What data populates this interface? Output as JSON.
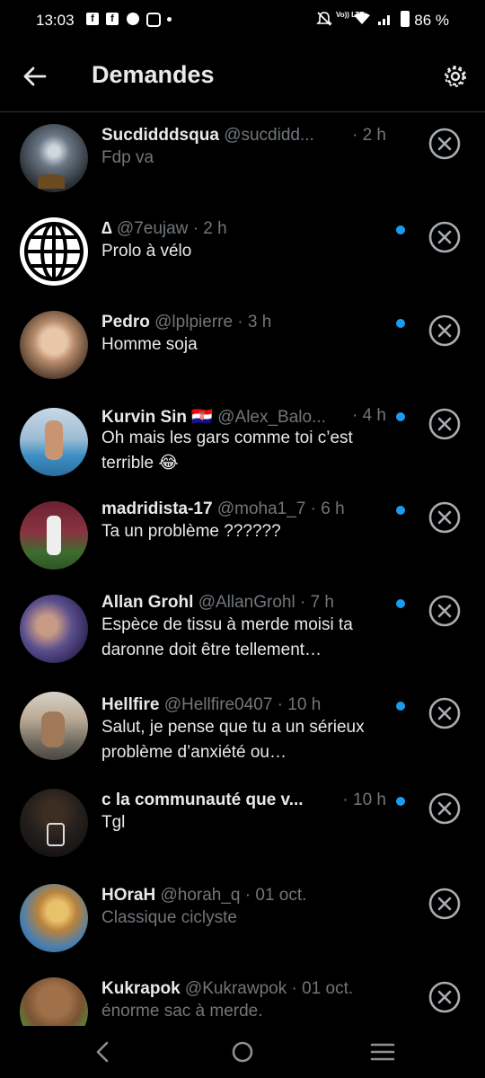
{
  "status_bar": {
    "time": "13:03",
    "left_icons": [
      "facebook-icon",
      "facebook-icon",
      "messenger-icon",
      "instagram-icon",
      "dot-icon"
    ],
    "volte": "Vo)) LTE",
    "battery": "86 %",
    "right_icons": [
      "mute-icon",
      "wifi-icon",
      "signal-icon",
      "battery-icon"
    ]
  },
  "header": {
    "title": "Demandes",
    "back_icon": "arrow-left-icon",
    "settings_icon": "gear-icon"
  },
  "requests": [
    {
      "name": "Sucdidddsqua",
      "handle": "@sucdidd...",
      "time": "· 2 h",
      "message": "Fdp va",
      "unread": false,
      "avatar": "night-sky-photo"
    },
    {
      "name": "∆",
      "handle": "@7eujaw",
      "time": "· 2 h",
      "message": "Prolo à vélo",
      "unread": true,
      "avatar": "globe-icon"
    },
    {
      "name": "Pedro",
      "handle": "@lplpierre",
      "time": "· 3 h",
      "message": "Homme soja",
      "unread": true,
      "avatar": "portrait-photo"
    },
    {
      "name": "Kurvin Sin 🇭🇷",
      "handle": "@Alex_Balo...",
      "time": "· 4 h",
      "message": "Oh mais les gars comme toi c’est terrible 😂",
      "unread": true,
      "avatar": "pool-photo"
    },
    {
      "name": "madridista-17",
      "handle": "@moha1_7",
      "time": "· 6 h",
      "message": "Ta un problème ??????",
      "unread": true,
      "avatar": "football-photo"
    },
    {
      "name": "Allan Grohl",
      "handle": "@AllanGrohl",
      "time": "· 7 h",
      "message": "Espèce de tissu à merde moisi ta daronne doit être tellement…",
      "unread": true,
      "avatar": "fighter-photo"
    },
    {
      "name": "Hellfire",
      "handle": "@Hellfire0407",
      "time": "· 10 h",
      "message": "Salut, je pense que tu a un sérieux problème d’anxiété ou…",
      "unread": true,
      "avatar": "mirror-selfie-photo"
    },
    {
      "name": "c la communauté que v...",
      "handle": "",
      "time": "· 10 h",
      "message": "Tgl",
      "unread": true,
      "avatar": "man-photo"
    },
    {
      "name": "HOraH",
      "handle": "@horah_q",
      "time": "· 01 oct.",
      "message": "Classique ciclyste",
      "unread": false,
      "avatar": "cartoon-character"
    },
    {
      "name": "Kukrapok",
      "handle": "@Kukrawpok",
      "time": "· 01 oct.",
      "message": "énorme sac à merde.",
      "unread": false,
      "avatar": "cartoon-bear"
    }
  ],
  "nav_bar": {
    "back_icon": "chevron-left-icon",
    "home_icon": "circle-home-icon",
    "recents_icon": "menu-lines-icon"
  },
  "colors": {
    "background": "#000000",
    "text_primary": "#e7e9ea",
    "text_secondary": "#71767b",
    "unread_dot": "#1d9bf0",
    "divider": "#2f3336"
  }
}
